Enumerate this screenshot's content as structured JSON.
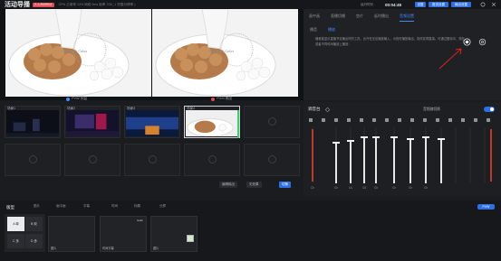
{
  "app": {
    "title": "活动导播",
    "live_badge": "2-1-2009011",
    "status": "CPU 占用率 13%  网络 0ms  帧率 7/30_1  完整分辨率 )",
    "runtime_label": "运行时长",
    "runtime": "00:04:48",
    "buttons": [
      "设置",
      "推流设置",
      "输出设置"
    ]
  },
  "preview": {
    "pvw_label": "PVW 预监",
    "pgm_label": "PGM 输出",
    "pvw_color": "#3f8cff",
    "pgm_color": "#e04b57",
    "watermark": "Handmade Cakes"
  },
  "scenes": [
    {
      "num": "场景1",
      "sub": "1"
    },
    {
      "num": "场景2",
      "sub": "2"
    },
    {
      "num": "场景3",
      "sub": "3-1"
    },
    {
      "num": "场景4",
      "sub": ""
    },
    {
      "num": "",
      "sub": ""
    }
  ],
  "scene_controls": {
    "left": "编辑输出",
    "mid": "无效果",
    "btn": "切换"
  },
  "right_panel": {
    "tabs": [
      "画中画",
      "直播切播",
      "垫片",
      "延时播出",
      "音频设置"
    ],
    "active_tab": 4,
    "subtabs": [
      "播音",
      "播放"
    ],
    "description": "播音能显示直播节目播出时的工具，允许在无法播放输入，为的时播放输出，操作变得直接。可通过图标中，现在或者不同时间播放上播放："
  },
  "mixer": {
    "title": "调音台",
    "follow_label": "音频随切换",
    "channels": [
      "Ch",
      "Ch",
      "1/L",
      "3/1",
      "Ch",
      "Ch",
      "Ch",
      "Ch"
    ]
  },
  "bottom": {
    "title": "版型",
    "buttons": [
      "图片",
      "画中画",
      "字幕",
      "时间",
      "标题",
      "分屏"
    ],
    "layouts": [
      "A 单",
      "B 双",
      "C 多",
      "D 多"
    ],
    "cards": [
      {
        "label": "图片",
        "tag": ""
      },
      {
        "label": "时间字幕",
        "tag": "Hello"
      },
      {
        "label": "图片",
        "tag": ""
      }
    ],
    "pvw_button": "PVW"
  }
}
